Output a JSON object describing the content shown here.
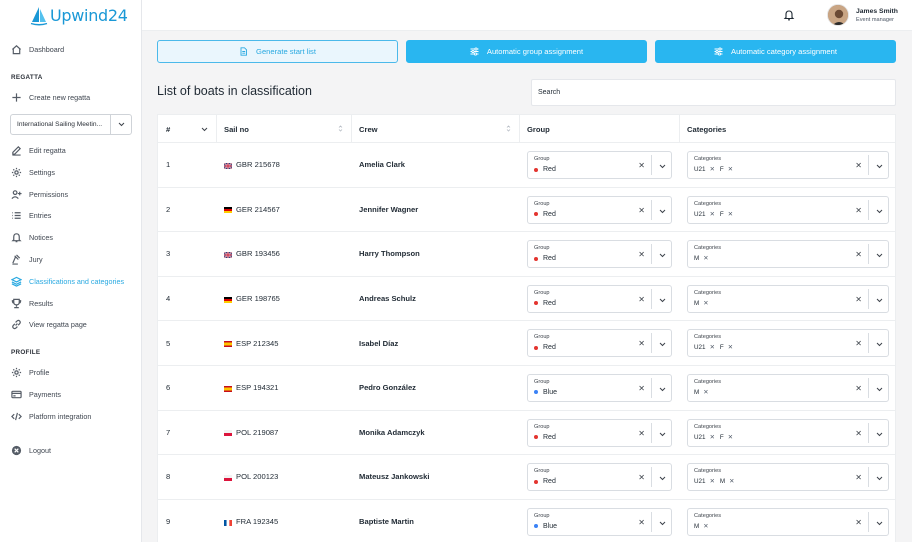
{
  "app": {
    "logo_text": "Upwind24"
  },
  "user": {
    "name": "James Smith",
    "role": "Event manager"
  },
  "sidebar": {
    "dashboard": "Dashboard",
    "regatta_label": "REGATTA",
    "create_new": "Create new regatta",
    "selected_regatta": "International Sailing Meetin...",
    "regatta_items": [
      "Edit regatta",
      "Settings",
      "Permissions",
      "Entries",
      "Notices",
      "Jury",
      "Classifications and categories",
      "Results",
      "View regatta page"
    ],
    "profile_label": "PROFILE",
    "profile_items": [
      "Profile",
      "Payments",
      "Platform integration"
    ],
    "logout": "Logout"
  },
  "toolbar": {
    "generate_start_list": "Generate start list",
    "auto_group": "Automatic group assignment",
    "auto_category": "Automatic category assignment"
  },
  "list": {
    "title": "List of boats in classification",
    "search_placeholder": "Search",
    "columns": {
      "num": "#",
      "sail": "Sail no",
      "crew": "Crew",
      "group": "Group",
      "categories": "Categories"
    },
    "group_field_label": "Group",
    "categories_field_label": "Categories"
  },
  "colors": {
    "accent": "#29b6f0",
    "red": "#e3342f",
    "blue": "#3b82f6"
  },
  "rows": [
    {
      "num": "1",
      "country": "GBR",
      "sail": "GBR 215678",
      "crew": "Amelia Clark",
      "group": "Red",
      "categories": [
        "U21",
        "F"
      ]
    },
    {
      "num": "2",
      "country": "GER",
      "sail": "GER 214567",
      "crew": "Jennifer Wagner",
      "group": "Red",
      "categories": [
        "U21",
        "F"
      ]
    },
    {
      "num": "3",
      "country": "GBR",
      "sail": "GBR 193456",
      "crew": "Harry Thompson",
      "group": "Red",
      "categories": [
        "M"
      ]
    },
    {
      "num": "4",
      "country": "GER",
      "sail": "GER 198765",
      "crew": "Andreas Schulz",
      "group": "Red",
      "categories": [
        "M"
      ]
    },
    {
      "num": "5",
      "country": "ESP",
      "sail": "ESP 212345",
      "crew": "Isabel Díaz",
      "group": "Red",
      "categories": [
        "U21",
        "F"
      ]
    },
    {
      "num": "6",
      "country": "ESP",
      "sail": "ESP 194321",
      "crew": "Pedro González",
      "group": "Blue",
      "categories": [
        "M"
      ]
    },
    {
      "num": "7",
      "country": "POL",
      "sail": "POL 219087",
      "crew": "Monika Adamczyk",
      "group": "Red",
      "categories": [
        "U21",
        "F"
      ]
    },
    {
      "num": "8",
      "country": "POL",
      "sail": "POL 200123",
      "crew": "Mateusz Jankowski",
      "group": "Red",
      "categories": [
        "U21",
        "M"
      ]
    },
    {
      "num": "9",
      "country": "FRA",
      "sail": "FRA 192345",
      "crew": "Baptiste Martin",
      "group": "Blue",
      "categories": [
        "M"
      ]
    }
  ]
}
